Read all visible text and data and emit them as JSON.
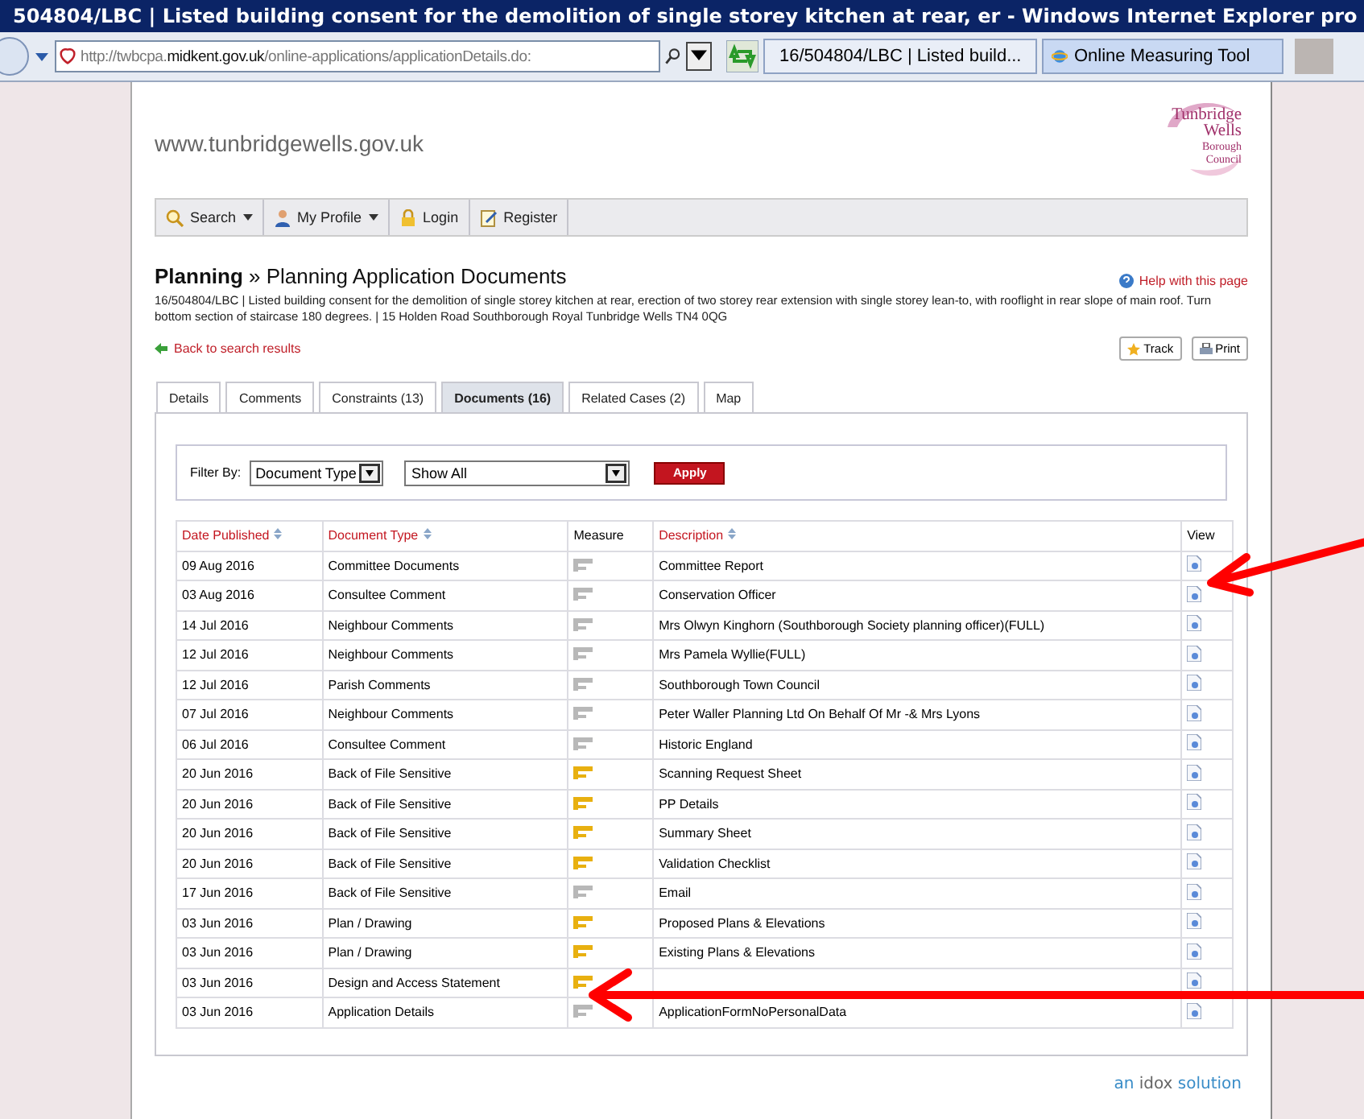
{
  "window": {
    "title": "504804/LBC | Listed building consent for the demolition of single storey kitchen at rear, er - Windows Internet Explorer pro"
  },
  "browser": {
    "address_prefix": "http://twbcpa.",
    "address_host": "midkent.gov.uk",
    "address_path": "/online-applications/applicationDetails.do:",
    "tabs": [
      {
        "label": "16/504804/LBC | Listed build...",
        "selected": true
      },
      {
        "label": "Online Measuring Tool",
        "selected": false
      }
    ]
  },
  "site": {
    "url": "www.tunbridgewells.gov.uk",
    "logo_lines": [
      "Tunbridge",
      "Wells",
      "Borough",
      "Council"
    ],
    "nav": [
      {
        "label": "Search",
        "kind": "search",
        "menu": true
      },
      {
        "label": "My Profile",
        "kind": "profile",
        "menu": true
      },
      {
        "label": "Login",
        "kind": "login",
        "menu": false
      },
      {
        "label": "Register",
        "kind": "register",
        "menu": false
      }
    ]
  },
  "heading": {
    "section": "Planning",
    "separator": "»",
    "title": "Planning Application Documents"
  },
  "help_link": "Help with this page",
  "summary": "16/504804/LBC | Listed building consent for the demolition of single storey kitchen at rear, erection of two storey rear extension with single storey lean-to, with rooflight in rear slope of main roof. Turn bottom section of staircase 180 degrees. | 15 Holden Road Southborough Royal Tunbridge Wells TN4 0QG",
  "back_link": "Back to search results",
  "actions": [
    "Track",
    "Print"
  ],
  "tabs": [
    {
      "label": "Details",
      "selected": false
    },
    {
      "label": "Comments",
      "selected": false
    },
    {
      "label": "Constraints (13)",
      "selected": false
    },
    {
      "label": "Documents (16)",
      "selected": true
    },
    {
      "label": "Related Cases (2)",
      "selected": false
    },
    {
      "label": "Map",
      "selected": false
    }
  ],
  "filter": {
    "label": "Filter By:",
    "type_value": "Document Type",
    "show_value": "Show All",
    "apply": "Apply"
  },
  "table": {
    "columns": [
      {
        "label": "Date Published",
        "sortable": true
      },
      {
        "label": "Document Type",
        "sortable": true
      },
      {
        "label": "Measure",
        "sortable": false
      },
      {
        "label": "Description",
        "sortable": true
      },
      {
        "label": "View",
        "sortable": false
      }
    ],
    "rows": [
      {
        "date": "09 Aug 2016",
        "type": "Committee Documents",
        "measurable": false,
        "description": "Committee Report"
      },
      {
        "date": "03 Aug 2016",
        "type": "Consultee Comment",
        "measurable": false,
        "description": "Conservation Officer"
      },
      {
        "date": "14 Jul 2016",
        "type": "Neighbour Comments",
        "measurable": false,
        "description": "Mrs Olwyn Kinghorn (Southborough Society planning officer)(FULL)"
      },
      {
        "date": "12 Jul 2016",
        "type": "Neighbour Comments",
        "measurable": false,
        "description": "Mrs Pamela Wyllie(FULL)"
      },
      {
        "date": "12 Jul 2016",
        "type": "Parish Comments",
        "measurable": false,
        "description": "Southborough Town Council"
      },
      {
        "date": "07 Jul 2016",
        "type": "Neighbour Comments",
        "measurable": false,
        "description": "Peter Waller Planning Ltd On Behalf Of Mr -& Mrs Lyons"
      },
      {
        "date": "06 Jul 2016",
        "type": "Consultee Comment",
        "measurable": false,
        "description": "Historic England"
      },
      {
        "date": "20 Jun 2016",
        "type": "Back of File Sensitive",
        "measurable": true,
        "description": "Scanning Request Sheet"
      },
      {
        "date": "20 Jun 2016",
        "type": "Back of File Sensitive",
        "measurable": true,
        "description": "PP Details"
      },
      {
        "date": "20 Jun 2016",
        "type": "Back of File Sensitive",
        "measurable": true,
        "description": "Summary Sheet"
      },
      {
        "date": "20 Jun 2016",
        "type": "Back of File Sensitive",
        "measurable": true,
        "description": "Validation Checklist"
      },
      {
        "date": "17 Jun 2016",
        "type": "Back of File Sensitive",
        "measurable": false,
        "description": "Email"
      },
      {
        "date": "03 Jun 2016",
        "type": "Plan / Drawing",
        "measurable": true,
        "description": "Proposed Plans & Elevations"
      },
      {
        "date": "03 Jun 2016",
        "type": "Plan / Drawing",
        "measurable": true,
        "description": "Existing Plans & Elevations"
      },
      {
        "date": "03 Jun 2016",
        "type": "Design and Access Statement",
        "measurable": true
      },
      {
        "date": "03 Jun 2016",
        "type": "Application Details",
        "measurable": false,
        "description": "ApplicationFormNoPersonalData"
      }
    ]
  },
  "footer": {
    "prefix": "an",
    "brand": "idox",
    "suffix": "solution"
  }
}
